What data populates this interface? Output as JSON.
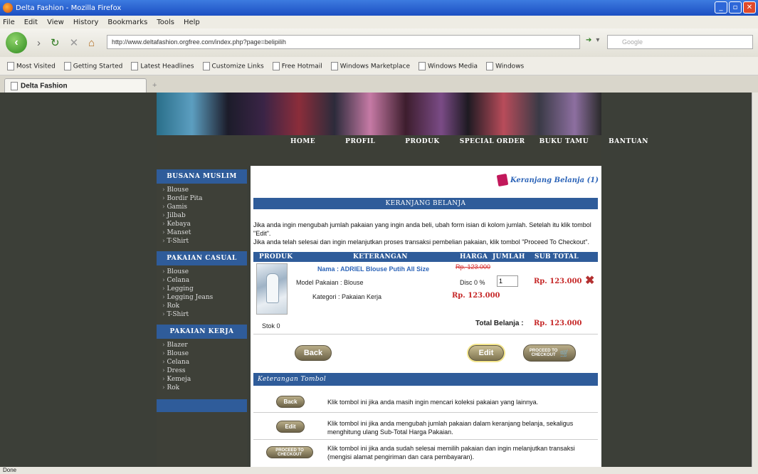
{
  "window": {
    "title": "Delta Fashion - Mozilla Firefox"
  },
  "menu": [
    "File",
    "Edit",
    "View",
    "History",
    "Bookmarks",
    "Tools",
    "Help"
  ],
  "nav": {
    "url": "http://www.deltafashion.orgfree.com/index.php?page=belipilih",
    "search_placeholder": "Google"
  },
  "bookmarks": [
    "Most Visited",
    "Getting Started",
    "Latest Headlines",
    "Customize Links",
    "Free Hotmail",
    "Windows Marketplace",
    "Windows Media",
    "Windows"
  ],
  "tab": {
    "label": "Delta Fashion",
    "new_tab": "+"
  },
  "site": {
    "topnav": [
      "HOME",
      "PROFIL",
      "PRODUK",
      "SPECIAL ORDER",
      "BUKU TAMU",
      "BANTUAN"
    ],
    "sidebar": [
      {
        "heading": "BUSANA MUSLIM",
        "items": [
          "Blouse",
          "Bordir Pita",
          "Gamis",
          "Jilbab",
          "Kebaya",
          "Manset",
          "T-Shirt"
        ]
      },
      {
        "heading": "PAKAIAN CASUAL",
        "items": [
          "Blouse",
          "Celana",
          "Legging",
          "Legging Jeans",
          "Rok",
          "T-Shirt"
        ]
      },
      {
        "heading": "PAKAIAN KERJA",
        "items": [
          "Blazer",
          "Blouse",
          "Celana",
          "Dress",
          "Kemeja",
          "Rok"
        ]
      }
    ],
    "cart": {
      "link": "Keranjang Belanja (1)",
      "heading": "KERANJANG BELANJA",
      "info1": "Jika anda ingin mengubah jumlah pakaian yang ingin anda beli, ubah form isian di kolom jumlah. Setelah itu klik tombol \"Edit\".",
      "info2": "Jika anda telah selesai dan ingin melanjutkan proses transaksi pembelian pakaian, klik tombol \"Proceed To Checkout\".",
      "columns": {
        "produk": "PRODUK",
        "keterangan": "KETERANGAN",
        "harga": "HARGA",
        "jumlah": "JUMLAH",
        "subtotal": "SUB TOTAL"
      },
      "item": {
        "name": "Nama : ADRIEL Blouse Putih All Size",
        "model": "Model Pakaian : Blouse",
        "kategori": "Kategori : Pakaian Kerja",
        "old_price": "Rp. 123.000",
        "discount": "Disc 0 %",
        "qty": "1",
        "price": "Rp. 123.000",
        "subtotal": "Rp. 123.000"
      },
      "stok": "Stok 0",
      "total_label": "Total Belanja :",
      "total_value": "Rp. 123.000",
      "buttons": {
        "back": "Back",
        "edit": "Edit",
        "checkout": "PROCEED TO CHECKOUT"
      }
    },
    "help": {
      "heading": "Keterangan Tombol",
      "rows": [
        {
          "button": "Back",
          "text": "Klik tombol ini jika anda masih ingin mencari koleksi pakaian yang lainnya."
        },
        {
          "button": "Edit",
          "text": "Klik tombol ini jika anda mengubah jumlah pakaian dalam keranjang belanja, sekaligus menghitung ulang Sub-Total Harga Pakaian."
        },
        {
          "button": "PROCEED TO CHECKOUT",
          "text": "Klik tombol ini jika anda sudah selesai memilih pakaian dan ingin melanjutkan transaksi (mengisi alamat pengiriman dan cara pembayaran)."
        }
      ]
    }
  },
  "status": "Done"
}
